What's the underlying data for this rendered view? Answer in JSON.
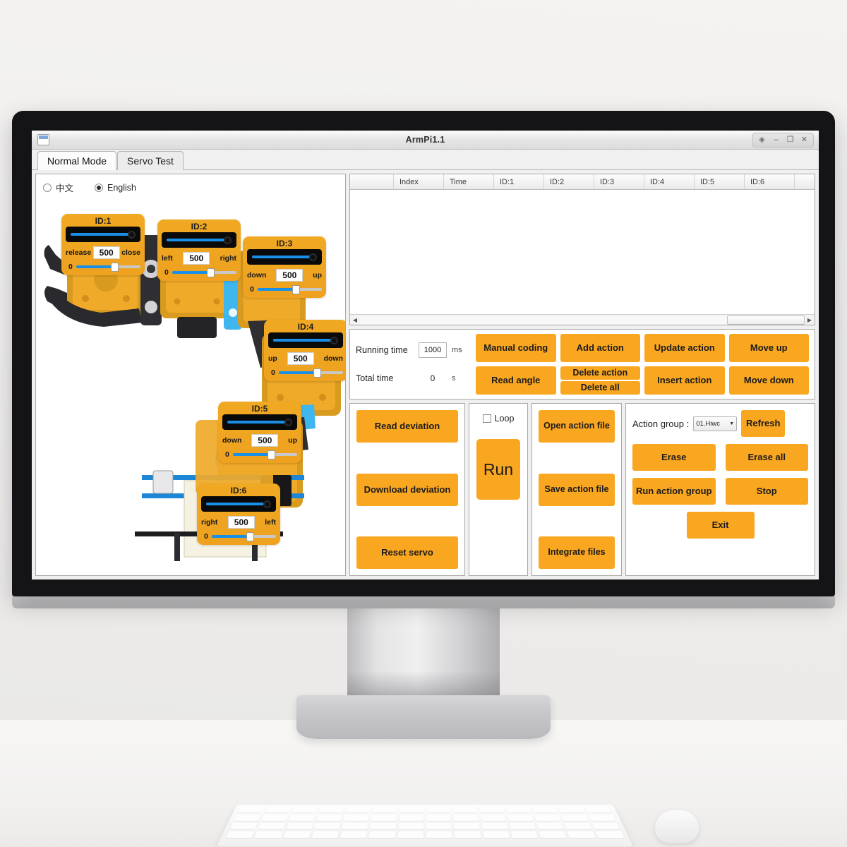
{
  "window": {
    "title": "ArmPi1.1",
    "menu_icon": "window-menu-icon",
    "buttons": [
      {
        "name": "help-button",
        "glyph": "◈"
      },
      {
        "name": "minimize-button",
        "glyph": "–"
      },
      {
        "name": "maximize-button",
        "glyph": "❐"
      },
      {
        "name": "close-button",
        "glyph": "✕"
      }
    ]
  },
  "tabs": [
    {
      "label": "Normal Mode",
      "active": true
    },
    {
      "label": "Servo Test",
      "active": false
    }
  ],
  "language": {
    "options": [
      {
        "label": "中文",
        "selected": false
      },
      {
        "label": "English",
        "selected": true
      }
    ]
  },
  "servos": [
    {
      "id_label": "ID:1",
      "left_label": "release",
      "right_label": "close",
      "value": "500",
      "deviation": "0"
    },
    {
      "id_label": "ID:2",
      "left_label": "left",
      "right_label": "right",
      "value": "500",
      "deviation": "0"
    },
    {
      "id_label": "ID:3",
      "left_label": "down",
      "right_label": "up",
      "value": "500",
      "deviation": "0"
    },
    {
      "id_label": "ID:4",
      "left_label": "up",
      "right_label": "down",
      "value": "500",
      "deviation": "0"
    },
    {
      "id_label": "ID:5",
      "left_label": "down",
      "right_label": "up",
      "value": "500",
      "deviation": "0"
    },
    {
      "id_label": "ID:6",
      "left_label": "right",
      "right_label": "left",
      "value": "500",
      "deviation": "0"
    }
  ],
  "action_table": {
    "columns": [
      "Index",
      "Time",
      "ID:1",
      "ID:2",
      "ID:3",
      "ID:4",
      "ID:5",
      "ID:6"
    ],
    "rows": []
  },
  "action_controls": {
    "running_time_label": "Running time",
    "running_time_value": "1000",
    "running_time_unit": "ms",
    "total_time_label": "Total time",
    "total_time_value": "0",
    "total_time_unit": "s",
    "manual_coding": "Manual coding",
    "add_action": "Add action",
    "update_action": "Update action",
    "move_up": "Move up",
    "read_angle": "Read angle",
    "delete_action": "Delete action",
    "delete_all": "Delete all",
    "insert_action": "Insert action",
    "move_down": "Move down"
  },
  "deviation_panel": {
    "read_deviation": "Read deviation",
    "download_deviation": "Download deviation",
    "reset_servo": "Reset servo"
  },
  "run_panel": {
    "loop_label": "Loop",
    "loop_checked": false,
    "run_label": "Run"
  },
  "file_panel": {
    "open_action_file": "Open action file",
    "save_action_file": "Save action file",
    "integrate_files": "Integrate files"
  },
  "group_panel": {
    "label": "Action group :",
    "selected_group": "01.Hiwc",
    "refresh": "Refresh",
    "erase": "Erase",
    "erase_all": "Erase all",
    "run_action_group": "Run action group",
    "stop": "Stop",
    "exit": "Exit"
  },
  "colors": {
    "accent_orange": "#f9a620",
    "slider_blue": "#1a8fe8",
    "servo_card": "#f0a922"
  }
}
